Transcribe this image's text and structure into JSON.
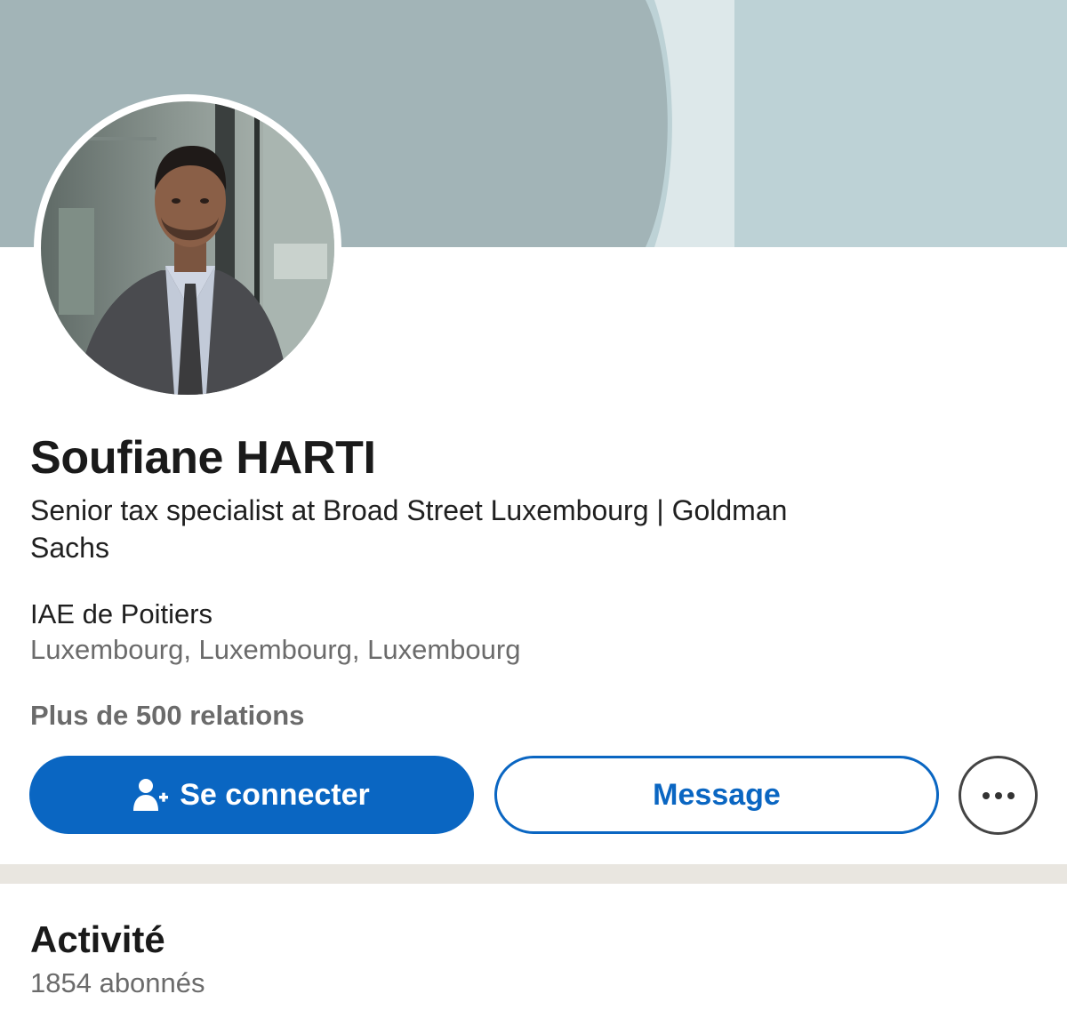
{
  "profile": {
    "name": "Soufiane HARTI",
    "headline": "Senior tax specialist at Broad Street Luxembourg | Goldman Sachs",
    "school": "IAE de Poitiers",
    "location": "Luxembourg, Luxembourg, Luxembourg",
    "connections": "Plus de 500 relations"
  },
  "actions": {
    "connect_label": "Se connecter",
    "connect_icon": "add-person-icon",
    "message_label": "Message",
    "more_icon": "ellipsis-icon"
  },
  "activity": {
    "title": "Activité",
    "followers": "1854 abonnés"
  },
  "colors": {
    "accent": "#0a66c2",
    "cover_light": "#bdd2d6",
    "cover_dark": "#a2b4b7",
    "divider": "#e9e6e0",
    "secondary_text": "#6b6b6b"
  }
}
